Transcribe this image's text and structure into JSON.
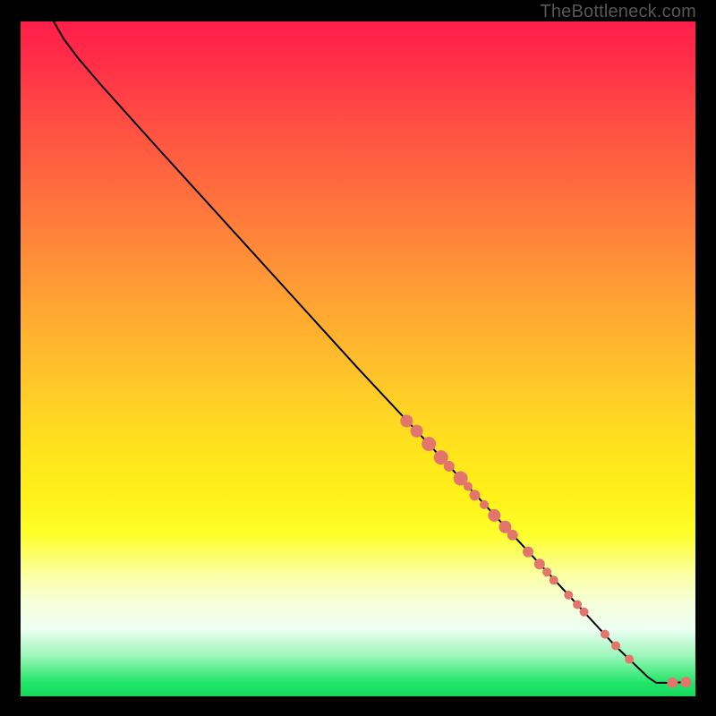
{
  "attribution": "TheBottleneck.com",
  "colors": {
    "point": "#e2766d",
    "curve": "#000000"
  },
  "chart_data": {
    "type": "line",
    "title": "",
    "xlabel": "",
    "ylabel": "",
    "xlim": [
      0,
      100
    ],
    "ylim": [
      0,
      100
    ],
    "grid": false,
    "legend": false,
    "curve": [
      {
        "x": 4.9,
        "y": 100.0
      },
      {
        "x": 6.4,
        "y": 97.4
      },
      {
        "x": 8.5,
        "y": 94.6
      },
      {
        "x": 12.0,
        "y": 90.5
      },
      {
        "x": 20.0,
        "y": 81.6
      },
      {
        "x": 30.0,
        "y": 70.6
      },
      {
        "x": 40.0,
        "y": 59.6
      },
      {
        "x": 50.0,
        "y": 48.6
      },
      {
        "x": 60.0,
        "y": 37.9
      },
      {
        "x": 70.0,
        "y": 27.1
      },
      {
        "x": 80.0,
        "y": 16.3
      },
      {
        "x": 88.0,
        "y": 7.6
      },
      {
        "x": 93.0,
        "y": 2.8
      },
      {
        "x": 94.2,
        "y": 2.0
      },
      {
        "x": 96.5,
        "y": 2.0
      },
      {
        "x": 98.5,
        "y": 2.1
      }
    ],
    "points": [
      {
        "x": 57.2,
        "y": 40.8,
        "r": 7
      },
      {
        "x": 58.7,
        "y": 39.3,
        "r": 7
      },
      {
        "x": 60.5,
        "y": 37.4,
        "r": 8
      },
      {
        "x": 62.3,
        "y": 35.4,
        "r": 8
      },
      {
        "x": 63.5,
        "y": 34.1,
        "r": 6
      },
      {
        "x": 65.2,
        "y": 32.3,
        "r": 8
      },
      {
        "x": 66.3,
        "y": 31.1,
        "r": 5
      },
      {
        "x": 67.3,
        "y": 29.8,
        "r": 6
      },
      {
        "x": 68.7,
        "y": 28.4,
        "r": 5
      },
      {
        "x": 70.2,
        "y": 26.8,
        "r": 7
      },
      {
        "x": 71.8,
        "y": 25.1,
        "r": 7
      },
      {
        "x": 72.9,
        "y": 23.9,
        "r": 6
      },
      {
        "x": 75.2,
        "y": 21.4,
        "r": 6
      },
      {
        "x": 76.9,
        "y": 19.6,
        "r": 6
      },
      {
        "x": 78.0,
        "y": 18.4,
        "r": 5
      },
      {
        "x": 79.0,
        "y": 17.2,
        "r": 5
      },
      {
        "x": 81.2,
        "y": 15.0,
        "r": 5
      },
      {
        "x": 82.5,
        "y": 13.6,
        "r": 5
      },
      {
        "x": 83.5,
        "y": 12.5,
        "r": 5
      },
      {
        "x": 86.6,
        "y": 9.2,
        "r": 5
      },
      {
        "x": 88.2,
        "y": 7.5,
        "r": 5
      },
      {
        "x": 90.2,
        "y": 5.5,
        "r": 5
      },
      {
        "x": 96.6,
        "y": 2.0,
        "r": 6
      },
      {
        "x": 98.6,
        "y": 2.1,
        "r": 6
      }
    ]
  }
}
